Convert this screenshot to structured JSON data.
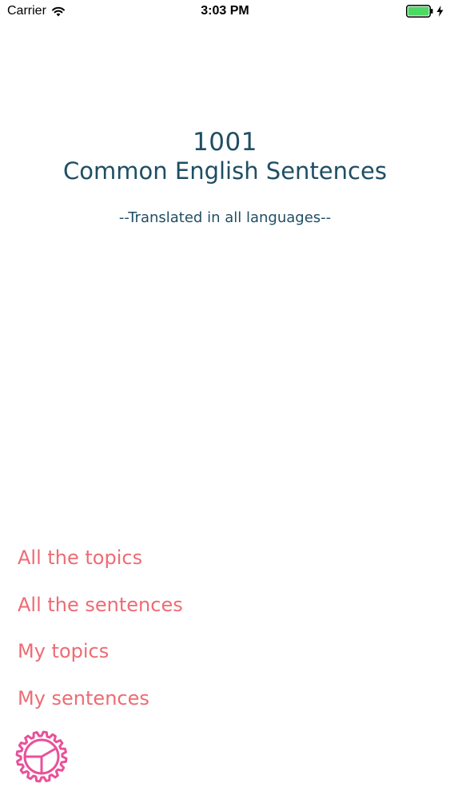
{
  "status_bar": {
    "carrier": "Carrier",
    "time": "3:03 PM",
    "battery_color": "#4cd964"
  },
  "header": {
    "number": "1001",
    "title": "Common English Sentences",
    "subtitle": "--Translated in all languages--",
    "color": "#1f4e63"
  },
  "menu": {
    "color": "#ee6b74",
    "items": [
      {
        "label": "All the topics"
      },
      {
        "label": "All the sentences"
      },
      {
        "label": "My topics"
      },
      {
        "label": "My sentences"
      }
    ]
  },
  "settings": {
    "icon": "gear-icon",
    "color": "#e8519a"
  }
}
